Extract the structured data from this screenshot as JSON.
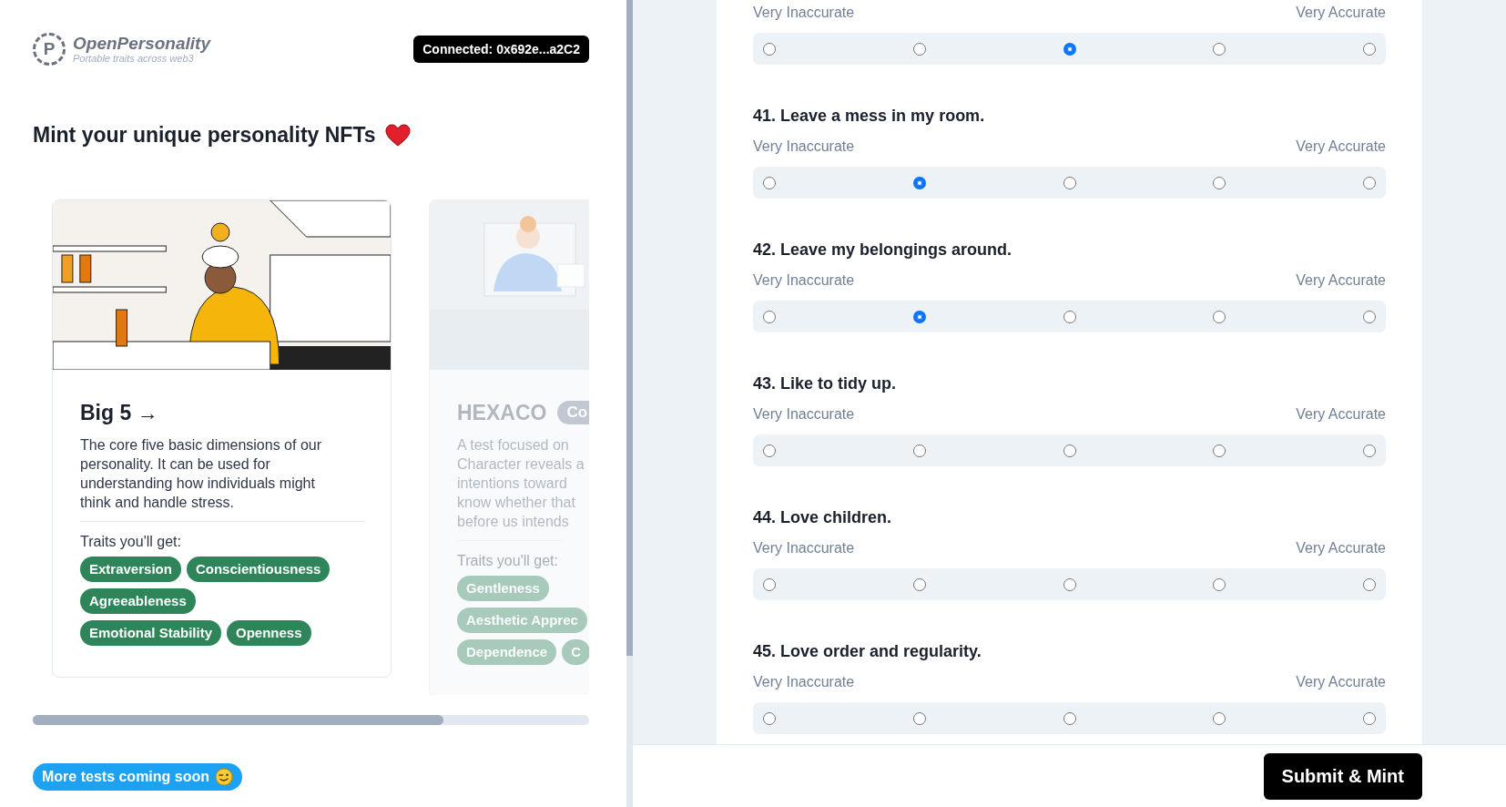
{
  "header": {
    "logo_letter": "P",
    "brand": "OpenPersonality",
    "tagline": "Portable traits across web3",
    "wallet": "Connected: 0x692e...a2C2"
  },
  "heading": "Mint your unique personality NFTs",
  "cards": [
    {
      "title": "Big 5 →",
      "active": true,
      "description_lines": [
        "The core five basic dimensions of our",
        "personality. It can be used for",
        "understanding how individuals might",
        "think and handle stress."
      ],
      "traits_label": "Traits you'll get:",
      "trait_rows": [
        [
          "Extraversion",
          "Conscientiousness"
        ],
        [
          "Agreeableness"
        ],
        [
          "Emotional Stability",
          "Openness"
        ]
      ]
    },
    {
      "title": "HEXACO",
      "badge": "Co",
      "active": false,
      "description_lines": [
        "A test focused on",
        "Character reveals a",
        "intentions toward",
        "know whether that",
        "before us intends"
      ],
      "traits_label": "Traits you'll get:",
      "trait_rows": [
        [
          "Gentleness"
        ],
        [
          "Aesthetic Apprec"
        ],
        [
          "Dependence",
          "C"
        ]
      ]
    }
  ],
  "coming_soon": "More tests coming soon",
  "questions": [
    {
      "low_label": "Very Inaccurate",
      "high_label": "Very Accurate",
      "options": [
        {
          "selected": false
        },
        {
          "selected": false
        },
        {
          "selected": true
        },
        {
          "selected": false
        },
        {
          "selected": false
        }
      ]
    },
    {
      "title": "41. Leave a mess in my room.",
      "low_label": "Very Inaccurate",
      "high_label": "Very Accurate",
      "options": [
        {
          "selected": false
        },
        {
          "selected": true
        },
        {
          "selected": false
        },
        {
          "selected": false
        },
        {
          "selected": false
        }
      ]
    },
    {
      "title": "42. Leave my belongings around.",
      "low_label": "Very Inaccurate",
      "high_label": "Very Accurate",
      "options": [
        {
          "selected": false
        },
        {
          "selected": true
        },
        {
          "selected": false
        },
        {
          "selected": false
        },
        {
          "selected": false
        }
      ]
    },
    {
      "title": "43. Like to tidy up.",
      "low_label": "Very Inaccurate",
      "high_label": "Very Accurate",
      "options": [
        {
          "selected": false
        },
        {
          "selected": false
        },
        {
          "selected": false
        },
        {
          "selected": false
        },
        {
          "selected": false
        }
      ]
    },
    {
      "title": "44. Love children.",
      "low_label": "Very Inaccurate",
      "high_label": "Very Accurate",
      "options": [
        {
          "selected": false
        },
        {
          "selected": false
        },
        {
          "selected": false
        },
        {
          "selected": false
        },
        {
          "selected": false
        }
      ]
    },
    {
      "title": "45. Love order and regularity.",
      "low_label": "Very Inaccurate",
      "high_label": "Very Accurate",
      "options": [
        {
          "selected": false
        },
        {
          "selected": false
        },
        {
          "selected": false
        },
        {
          "selected": false
        },
        {
          "selected": false
        }
      ]
    }
  ],
  "submit_button": "Submit & Mint"
}
